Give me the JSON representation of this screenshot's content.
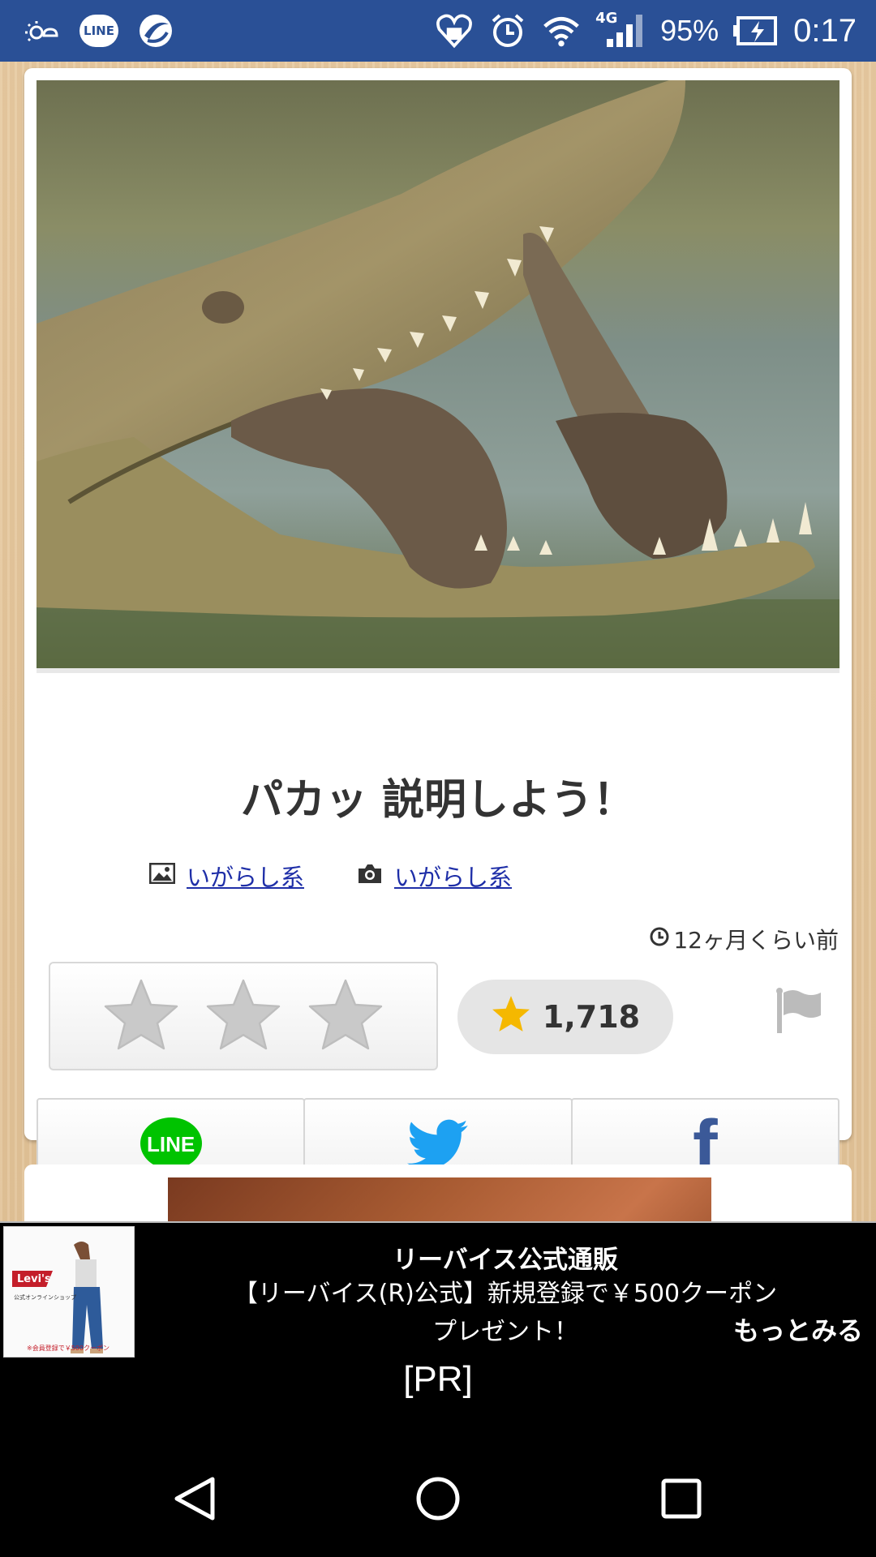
{
  "status_bar": {
    "battery": "95%",
    "time": "0:17",
    "network": "4G",
    "line_badge": "LINE",
    "icons": [
      "weather-icon",
      "line-app-icon",
      "browser-app-icon",
      "health-app-icon",
      "alarm-icon",
      "wifi-icon",
      "signal-icon",
      "battery-icon"
    ]
  },
  "post": {
    "title": "パカッ 説明しよう！",
    "image_author": "いがらし系",
    "photo_author": "いがらし系",
    "time_ago": "12ヶ月くらい前",
    "rating_count": "1,718",
    "rating_stars_total": 3
  },
  "share": {
    "line_label": "LINE",
    "twitter_icon": "twitter-bird-icon",
    "facebook_label": "f"
  },
  "ad": {
    "title": "リーバイス公式通販",
    "description_line1": "【リーバイス(R)公式】新規登録で￥500クーポン",
    "description_line2": "プレゼント！",
    "more": "もっとみる",
    "pr": "[PR]",
    "brand": "Levi's",
    "thumb_caption1": "公式オンラインショップ",
    "thumb_caption2": "※会員登録で￥500クーポン"
  },
  "colors": {
    "status_bar": "#2a5096",
    "link": "#1f2fa8",
    "line_green": "#00c300",
    "twitter_blue": "#1da1f2",
    "facebook_blue": "#3b5998",
    "star_gold": "#f5b800"
  }
}
